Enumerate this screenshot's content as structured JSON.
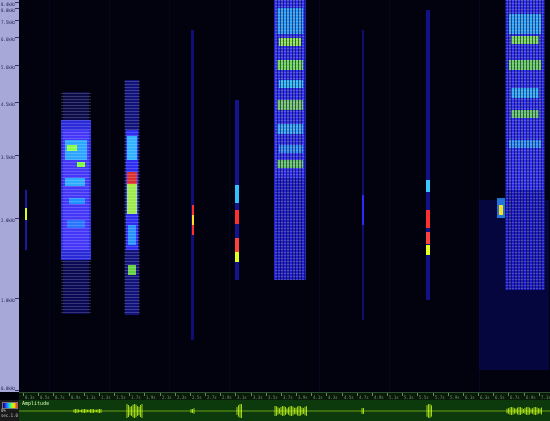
{
  "freq_ruler": {
    "ticks": [
      {
        "label": "8.4kHz",
        "pos": 0.005
      },
      {
        "label": "8.0kHz",
        "pos": 0.02
      },
      {
        "label": "7.5kHz",
        "pos": 0.05
      },
      {
        "label": "6.6kHz",
        "pos": 0.095
      },
      {
        "label": "5.6kHz",
        "pos": 0.165
      },
      {
        "label": "4.5kHz",
        "pos": 0.26
      },
      {
        "label": "3.5kHz",
        "pos": 0.395
      },
      {
        "label": "2.0kHz",
        "pos": 0.555
      },
      {
        "label": "1.0kHz",
        "pos": 0.76
      },
      {
        "label": "0.0kHz",
        "pos": 0.995
      }
    ]
  },
  "time_ruler": {
    "labels": [
      "0.3s",
      "0.5s",
      "0.7s",
      "0.9s",
      "1.1s",
      "1.3s",
      "1.5s",
      "1.7s",
      "1.9s",
      "2.1s",
      "2.3s",
      "2.5s",
      "2.7s",
      "2.9s",
      "3.1s",
      "3.3s",
      "3.5s",
      "3.7s",
      "3.9s",
      "4.1s",
      "4.3s",
      "4.5s",
      "4.7s",
      "4.9s",
      "5.1s",
      "5.3s",
      "5.5s",
      "5.7s",
      "5.9s",
      "6.1s",
      "6.3s",
      "6.5s",
      "6.7s",
      "6.9s",
      "7.1s"
    ]
  },
  "amplitude": {
    "label": "Amplitude",
    "left_labels": [
      "0%",
      "sec.1.0"
    ]
  },
  "colors": {
    "spectro_bg": "#00000a",
    "ruler_bg": "#a8a8d8",
    "amp_bg": "#0d3a0d",
    "wave": "#c8ff1a"
  }
}
